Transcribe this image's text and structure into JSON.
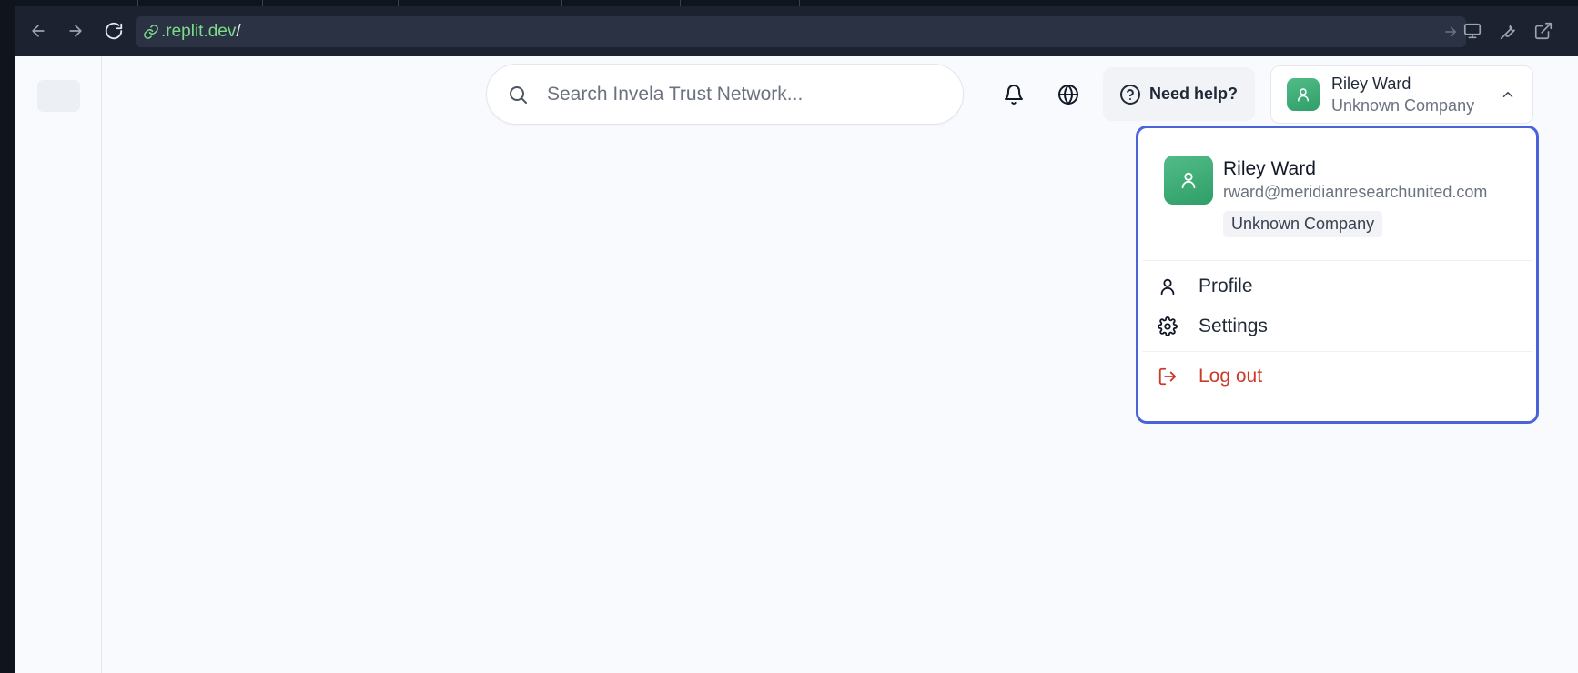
{
  "browser": {
    "url_domain": ".replit.dev",
    "url_path": "/"
  },
  "header": {
    "search_placeholder": "Search Invela Trust Network...",
    "help_label": "Need help?",
    "user": {
      "name": "Riley Ward",
      "company": "Unknown Company"
    }
  },
  "user_menu": {
    "name": "Riley Ward",
    "email": "rward@meridianresearchunited.com",
    "company_badge": "Unknown Company",
    "items": [
      {
        "label": "Profile",
        "icon": "user-icon"
      },
      {
        "label": "Settings",
        "icon": "gear-icon"
      },
      {
        "label": "Log out",
        "icon": "logout-icon"
      }
    ]
  },
  "colors": {
    "accent_border": "#4a63d8",
    "avatar_green": "#3faa77",
    "logout_red": "#cc3a2a",
    "url_green": "#7ddc8a"
  }
}
